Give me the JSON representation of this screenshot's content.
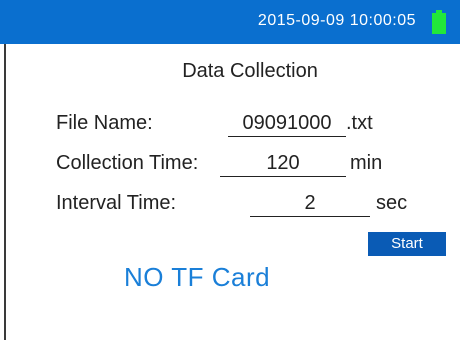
{
  "status_bar": {
    "datetime": "2015-09-09 10:00:05",
    "battery_icon": "battery-full-icon",
    "colors": {
      "bar": "#0a6fcf",
      "battery": "#22e83a"
    }
  },
  "screen": {
    "title": "Data Collection",
    "file_name": {
      "label": "File Name:",
      "value": "09091000",
      "extension": ".txt"
    },
    "collection_time": {
      "label": "Collection Time:",
      "value": "120",
      "unit": "min"
    },
    "interval_time": {
      "label": "Interval Time:",
      "value": "2",
      "unit": "sec"
    },
    "start_label": "Start",
    "tf_status": "NO TF Card",
    "colors": {
      "start_button": "#0a5bb5",
      "tf_status": "#1a7fd8"
    }
  }
}
